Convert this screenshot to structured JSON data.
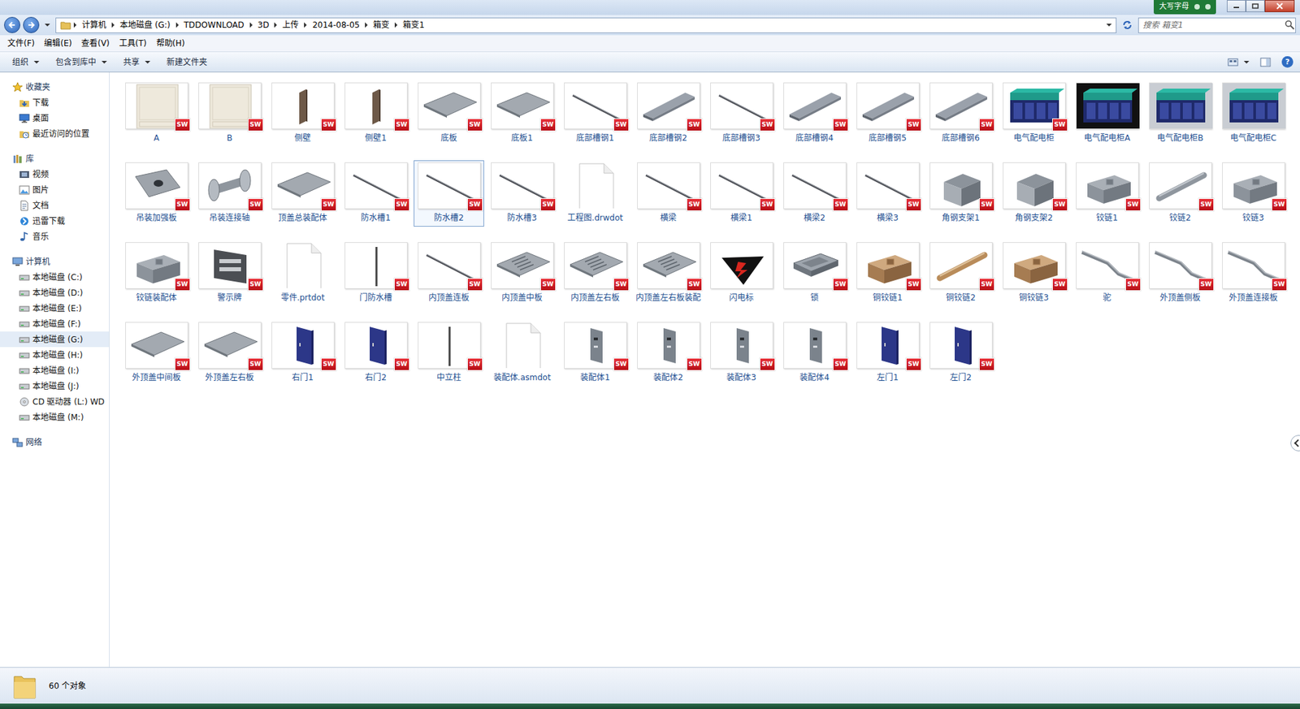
{
  "window": {
    "ime": "大写字母"
  },
  "address": {
    "crumbs": [
      "计算机",
      "本地磁盘 (G:)",
      "TDDOWNLOAD",
      "3D",
      "上传",
      "2014-08-05",
      "箱变",
      "箱变1"
    ],
    "search_placeholder": "搜索 箱变1"
  },
  "menu": [
    "文件(F)",
    "编辑(E)",
    "查看(V)",
    "工具(T)",
    "帮助(H)"
  ],
  "toolbar": {
    "buttons": [
      {
        "label": "组织",
        "dropdown": true
      },
      {
        "label": "包含到库中",
        "dropdown": true
      },
      {
        "label": "共享",
        "dropdown": true
      },
      {
        "label": "新建文件夹",
        "dropdown": false
      }
    ],
    "help": "?"
  },
  "nav": [
    {
      "label": "收藏夹",
      "kind": "favorites",
      "items": [
        {
          "label": "下载",
          "kind": "download",
          "selected": false
        },
        {
          "label": "桌面",
          "kind": "desktop",
          "selected": false
        },
        {
          "label": "最近访问的位置",
          "kind": "recent",
          "selected": false
        }
      ]
    },
    {
      "label": "库",
      "kind": "library",
      "items": [
        {
          "label": "视频",
          "kind": "video",
          "selected": false
        },
        {
          "label": "图片",
          "kind": "picture",
          "selected": false
        },
        {
          "label": "文档",
          "kind": "document",
          "selected": false
        },
        {
          "label": "迅雷下载",
          "kind": "thunder",
          "selected": false
        },
        {
          "label": "音乐",
          "kind": "music",
          "selected": false
        }
      ]
    },
    {
      "label": "计算机",
      "kind": "computer",
      "items": [
        {
          "label": "本地磁盘 (C:)",
          "kind": "drive",
          "selected": false
        },
        {
          "label": "本地磁盘 (D:)",
          "kind": "drive",
          "selected": false
        },
        {
          "label": "本地磁盘 (E:)",
          "kind": "drive",
          "selected": false
        },
        {
          "label": "本地磁盘 (F:)",
          "kind": "drive",
          "selected": false
        },
        {
          "label": "本地磁盘 (G:)",
          "kind": "drive",
          "selected": true
        },
        {
          "label": "本地磁盘 (H:)",
          "kind": "drive",
          "selected": false
        },
        {
          "label": "本地磁盘 (I:)",
          "kind": "drive",
          "selected": false
        },
        {
          "label": "本地磁盘 (J:)",
          "kind": "drive",
          "selected": false
        },
        {
          "label": "CD 驱动器 (L:) WD",
          "kind": "cd",
          "selected": false
        },
        {
          "label": "本地磁盘 (M:)",
          "kind": "drive",
          "selected": false
        }
      ]
    },
    {
      "label": "网络",
      "kind": "network",
      "items": []
    }
  ],
  "badge_text": "SW",
  "files": [
    {
      "name": "A",
      "kind": "drawing",
      "badge": true,
      "selected": false
    },
    {
      "name": "B",
      "kind": "drawing",
      "badge": true,
      "selected": false
    },
    {
      "name": "侧壁",
      "kind": "board",
      "badge": true,
      "selected": false
    },
    {
      "name": "侧壁1",
      "kind": "board",
      "badge": true,
      "selected": false
    },
    {
      "name": "底板",
      "kind": "plate",
      "badge": true,
      "selected": false
    },
    {
      "name": "底板1",
      "kind": "plate",
      "badge": true,
      "selected": false
    },
    {
      "name": "底部槽钢1",
      "kind": "rod",
      "badge": true,
      "selected": false
    },
    {
      "name": "底部槽钢2",
      "kind": "channel",
      "badge": true,
      "selected": false
    },
    {
      "name": "底部槽钢3",
      "kind": "rod",
      "badge": true,
      "selected": false
    },
    {
      "name": "底部槽钢4",
      "kind": "channel",
      "badge": true,
      "selected": false
    },
    {
      "name": "底部槽钢5",
      "kind": "channel",
      "badge": true,
      "selected": false
    },
    {
      "name": "底部槽钢6",
      "kind": "channel",
      "badge": true,
      "selected": false
    },
    {
      "name": "电气配电柜",
      "kind": "cabinet",
      "badge": true,
      "selected": false
    },
    {
      "name": "电气配电柜A",
      "kind": "cabinet-dark",
      "badge": false,
      "selected": false
    },
    {
      "name": "电气配电柜B",
      "kind": "cabinet-grey",
      "badge": false,
      "selected": false
    },
    {
      "name": "电气配电柜C",
      "kind": "cabinet-grey",
      "badge": false,
      "selected": false
    },
    {
      "name": "吊装加强板",
      "kind": "holeplate",
      "badge": true,
      "selected": false
    },
    {
      "name": "吊装连接轴",
      "kind": "shaft",
      "badge": true,
      "selected": false
    },
    {
      "name": "顶盖总装配体",
      "kind": "plate",
      "badge": true,
      "selected": false
    },
    {
      "name": "防水槽1",
      "kind": "rod",
      "badge": true,
      "selected": false
    },
    {
      "name": "防水槽2",
      "kind": "rod",
      "badge": true,
      "selected": true
    },
    {
      "name": "防水槽3",
      "kind": "rod",
      "badge": true,
      "selected": false
    },
    {
      "name": "工程图.drwdot",
      "kind": "doc",
      "badge": false,
      "selected": false
    },
    {
      "name": "横梁",
      "kind": "rod",
      "badge": true,
      "selected": false
    },
    {
      "name": "横梁1",
      "kind": "rod",
      "badge": true,
      "selected": false
    },
    {
      "name": "横梁2",
      "kind": "rod",
      "badge": true,
      "selected": false
    },
    {
      "name": "横梁3",
      "kind": "rod",
      "badge": true,
      "selected": false
    },
    {
      "name": "角钢支架1",
      "kind": "bracket",
      "badge": true,
      "selected": false
    },
    {
      "name": "角钢支架2",
      "kind": "bracket",
      "badge": true,
      "selected": false
    },
    {
      "name": "铰链1",
      "kind": "block",
      "badge": true,
      "selected": false
    },
    {
      "name": "铰链2",
      "kind": "pin",
      "badge": true,
      "selected": false
    },
    {
      "name": "铰链3",
      "kind": "block",
      "badge": true,
      "selected": false
    },
    {
      "name": "铰链装配体",
      "kind": "block",
      "badge": true,
      "selected": false
    },
    {
      "name": "警示牌",
      "kind": "sign",
      "badge": true,
      "selected": false
    },
    {
      "name": "零件.prtdot",
      "kind": "doc",
      "badge": false,
      "selected": false
    },
    {
      "name": "门防水槽",
      "kind": "post",
      "badge": true,
      "selected": false
    },
    {
      "name": "内顶盖连板",
      "kind": "rod",
      "badge": true,
      "selected": false
    },
    {
      "name": "内顶盖中板",
      "kind": "vent",
      "badge": true,
      "selected": false
    },
    {
      "name": "内顶盖左右板",
      "kind": "vent",
      "badge": true,
      "selected": false
    },
    {
      "name": "内顶盖左右板装配",
      "kind": "vent",
      "badge": true,
      "selected": false
    },
    {
      "name": "闪电标",
      "kind": "bolt",
      "badge": false,
      "selected": false
    },
    {
      "name": "锁",
      "kind": "lock",
      "badge": true,
      "selected": false
    },
    {
      "name": "铜铰链1",
      "kind": "bronze",
      "badge": true,
      "selected": false
    },
    {
      "name": "铜铰链2",
      "kind": "bronze-pin",
      "badge": true,
      "selected": false
    },
    {
      "name": "铜铰链3",
      "kind": "bronze",
      "badge": true,
      "selected": false
    },
    {
      "name": "驼",
      "kind": "arm",
      "badge": true,
      "selected": false
    },
    {
      "name": "外顶盖侧板",
      "kind": "arm",
      "badge": true,
      "selected": false
    },
    {
      "name": "外顶盖连接板",
      "kind": "arm",
      "badge": true,
      "selected": false
    },
    {
      "name": "外顶盖中间板",
      "kind": "plate",
      "badge": true,
      "selected": false
    },
    {
      "name": "外顶盖左右板",
      "kind": "plate",
      "badge": true,
      "selected": false
    },
    {
      "name": "右门1",
      "kind": "door",
      "badge": true,
      "selected": false
    },
    {
      "name": "右门2",
      "kind": "door",
      "badge": true,
      "selected": false
    },
    {
      "name": "中立柱",
      "kind": "post",
      "badge": true,
      "selected": false
    },
    {
      "name": "装配体.asmdot",
      "kind": "doc",
      "badge": false,
      "selected": false
    },
    {
      "name": "装配体1",
      "kind": "assembly",
      "badge": true,
      "selected": false
    },
    {
      "name": "装配体2",
      "kind": "assembly",
      "badge": true,
      "selected": false
    },
    {
      "name": "装配体3",
      "kind": "assembly",
      "badge": true,
      "selected": false
    },
    {
      "name": "装配体4",
      "kind": "assembly",
      "badge": true,
      "selected": false
    },
    {
      "name": "左门1",
      "kind": "door",
      "badge": true,
      "selected": false
    },
    {
      "name": "左门2",
      "kind": "door",
      "badge": true,
      "selected": false
    }
  ],
  "status": {
    "count": "60 个对象"
  }
}
